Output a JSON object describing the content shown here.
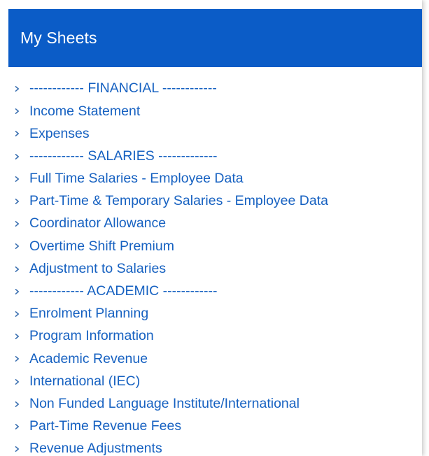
{
  "header": {
    "title": "My Sheets",
    "background_color": "#0b5cc7"
  },
  "colors": {
    "link": "#1661c1",
    "chevron": "#3a6fb0"
  },
  "list": {
    "items": [
      {
        "label": "------------ FINANCIAL ------------",
        "kind": "separator"
      },
      {
        "label": "Income Statement",
        "kind": "link"
      },
      {
        "label": "Expenses",
        "kind": "link"
      },
      {
        "label": "------------ SALARIES -------------",
        "kind": "separator"
      },
      {
        "label": "Full Time Salaries - Employee Data",
        "kind": "link"
      },
      {
        "label": "Part-Time & Temporary Salaries - Employee Data",
        "kind": "link"
      },
      {
        "label": "Coordinator Allowance",
        "kind": "link"
      },
      {
        "label": "Overtime Shift Premium",
        "kind": "link"
      },
      {
        "label": "Adjustment to Salaries",
        "kind": "link"
      },
      {
        "label": "------------ ACADEMIC ------------",
        "kind": "separator"
      },
      {
        "label": "Enrolment Planning",
        "kind": "link"
      },
      {
        "label": "Program Information",
        "kind": "link"
      },
      {
        "label": "Academic Revenue",
        "kind": "link"
      },
      {
        "label": "International (IEC)",
        "kind": "link"
      },
      {
        "label": "Non Funded Language Institute/International",
        "kind": "link"
      },
      {
        "label": "Part-Time Revenue Fees",
        "kind": "link"
      },
      {
        "label": "Revenue Adjustments",
        "kind": "link"
      }
    ]
  }
}
